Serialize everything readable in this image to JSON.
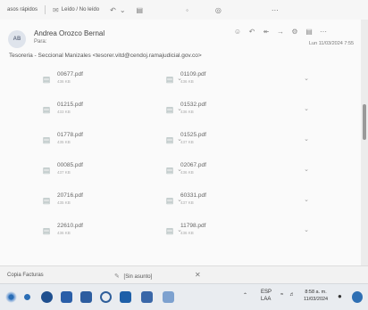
{
  "toolbar": {
    "quick_steps": "asos rápidos",
    "read_unread": "Leído / No leído"
  },
  "message": {
    "avatar_initials": "AB",
    "sender": "Andrea Orozco Bernal",
    "to": "Para:",
    "subject": "Tesoreria - Seccional Manizales <tesorer.vitd@cendoj.ramajudicial.gov.co>",
    "date": "Lun 11/03/2024 7:55"
  },
  "attachments": [
    {
      "name": "00677.pdf",
      "size": "436 KB"
    },
    {
      "name": "01109.pdf",
      "size": "436 KB"
    },
    {
      "name": "01215.pdf",
      "size": "433 KB"
    },
    {
      "name": "01532.pdf",
      "size": "436 KB"
    },
    {
      "name": "01778.pdf",
      "size": "435 KB"
    },
    {
      "name": "01525.pdf",
      "size": "437 KB"
    },
    {
      "name": "00085.pdf",
      "size": "437 KB"
    },
    {
      "name": "02067.pdf",
      "size": "436 KB"
    },
    {
      "name": "20716.pdf",
      "size": "435 KB"
    },
    {
      "name": "60331.pdf",
      "size": "437 KB"
    },
    {
      "name": "22610.pdf",
      "size": "436 KB"
    },
    {
      "name": "11798.pdf",
      "size": "436 KB"
    }
  ],
  "footer": {
    "draft_label": "Copia Facturas",
    "no_subject": "[Sin asunto]"
  },
  "taskbar": {
    "lang": "ESP",
    "lang2": "LAA",
    "time": "8:58 a. m.",
    "date": "11/03/2024"
  },
  "colors": {
    "accent": "#2f6fb3",
    "background": "#fafafa"
  }
}
